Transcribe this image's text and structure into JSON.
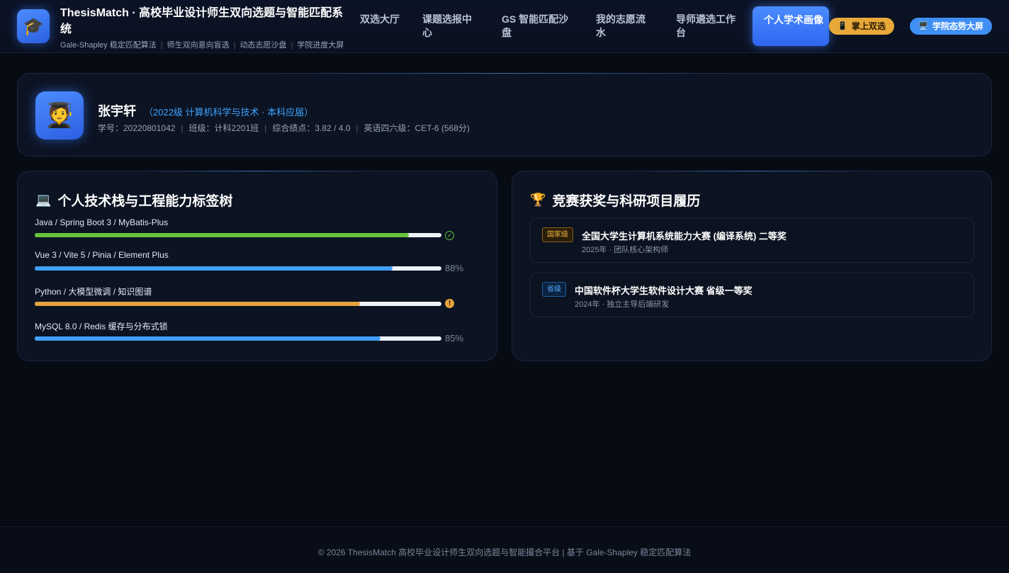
{
  "header": {
    "logo_icon": "graduation-cap-icon",
    "title": "ThesisMatch · 高校毕业设计师生双向选题与智能匹配系统",
    "subtitle_items": [
      "Gale-Shapley 稳定匹配算法",
      "师生双向意向盲选",
      "动态志愿沙盘",
      "学院进度大屏"
    ],
    "nav": [
      "双选大厅",
      "课题选报中心",
      "GS 智能匹配沙盘",
      "我的志愿流水",
      "导师遴选工作台",
      "个人学术画像"
    ],
    "active_nav": "个人学术画像",
    "pill_mobile": "掌上双选",
    "pill_screen": "学院态势大屏",
    "colors": {
      "accent": "#3f8ff5",
      "mobile_pill": "#e8a93a"
    }
  },
  "profile": {
    "avatar_icon": "student-avatar-icon",
    "name": "张宇轩",
    "tag": "（2022级 计算机科学与技术 · 本科应届）",
    "student_id": "学号：20220801042",
    "class": "班级：计科2201班",
    "gpa": "综合绩点：3.82 / 4.0",
    "english": "英语四六级：CET-6 (568分)"
  },
  "skills": {
    "title": "个人技术栈与工程能力标签树",
    "title_icon": "laptop-icon",
    "items": [
      {
        "label": "Java / Spring Boot 3 / MyBatis-Plus",
        "progress": 0.92,
        "color": "#67c23a",
        "status": "success",
        "end_text": ""
      },
      {
        "label": "Vue 3 / Vite 5 / Pinia / Element Plus",
        "progress": 0.88,
        "color": "#409eff",
        "status": "percent",
        "end_text": "88%"
      },
      {
        "label": "Python / 大模型微调 / 知识图谱",
        "progress": 0.8,
        "color": "#e6a23c",
        "status": "warning",
        "end_text": ""
      },
      {
        "label": "MySQL 8.0 / Redis 缓存与分布式锁",
        "progress": 0.85,
        "color": "#409eff",
        "status": "percent",
        "end_text": "85%"
      }
    ]
  },
  "awards": {
    "title": "竞赛获奖与科研项目履历",
    "title_icon": "trophy-icon",
    "items": [
      {
        "level": "国家级",
        "level_type": "national",
        "title": "全国大学生计算机系统能力大赛 (编译系统) 二等奖",
        "desc": "2025年 · 团队核心架构师"
      },
      {
        "level": "省级",
        "level_type": "provincial",
        "title": "中国软件杯大学生软件设计大赛 省级一等奖",
        "desc": "2024年 · 独立主导后端研发"
      }
    ]
  },
  "footer": {
    "text": "© 2026 ThesisMatch 高校毕业设计师生双向选题与智能撮合平台 | 基于 Gale-Shapley 稳定匹配算法"
  }
}
